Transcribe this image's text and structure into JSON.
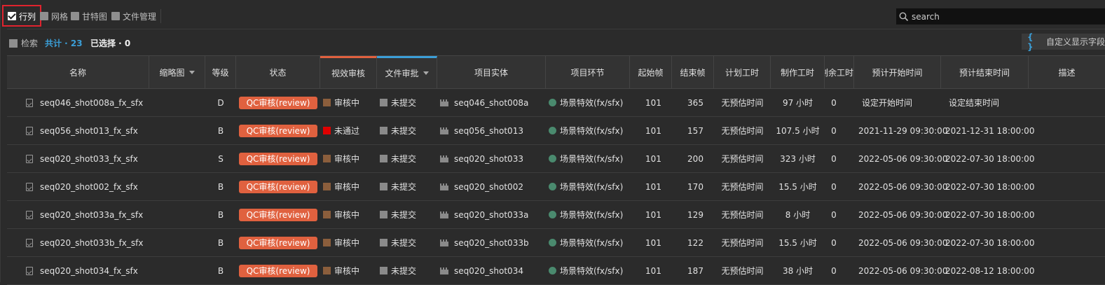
{
  "view_tabs": [
    {
      "label": "行列",
      "active": true
    },
    {
      "label": "网格",
      "active": false
    },
    {
      "label": "甘特图",
      "active": false
    },
    {
      "label": "文件管理",
      "active": false
    }
  ],
  "search": {
    "placeholder": "search"
  },
  "filter": {
    "label": "检索",
    "total_label": "共计 · 23",
    "selected_label": "已选择 · 0"
  },
  "custom_fields": {
    "icon": "{ }",
    "label": "自定义显示字段"
  },
  "columns": [
    "名称",
    "缩略图",
    "等级",
    "状态",
    "视效审核",
    "文件审批",
    "项目实体",
    "项目环节",
    "起始帧",
    "结束帧",
    "计划工时",
    "制作工时",
    "剩余工时",
    "预计开始时间",
    "预计结束时间",
    "描述"
  ],
  "colors": {
    "qc_badge": "#e0613f",
    "status_reviewing": "#8b5e3c",
    "status_rejected": "#e00000",
    "status_unsubmitted": "#8a8a8a",
    "stage_dot": "#4a8a6e",
    "date_bar": "#e56b6f",
    "highlight_border": "#e0232e",
    "accent_blue": "#3b9fd8"
  },
  "rows": [
    {
      "name": "seq046_shot008a_fx_sfx",
      "level": "D",
      "status": "QC审核(review)",
      "vfx_review": "审核中",
      "vfx_review_state": "reviewing",
      "file_approval": "未提交",
      "entity": "seq046_shot008a",
      "stage": "场景特效(fx/sfx)",
      "start_frame": "101",
      "end_frame": "365",
      "planned": "无预估时间",
      "actual": "97 小时",
      "remaining": "0",
      "est_start": "设定开始时间",
      "est_end": "设定结束时间",
      "dated": false
    },
    {
      "name": "seq056_shot013_fx_sfx",
      "level": "B",
      "status": "QC审核(review)",
      "vfx_review": "未通过",
      "vfx_review_state": "rejected",
      "file_approval": "未提交",
      "entity": "seq056_shot013",
      "stage": "场景特效(fx/sfx)",
      "start_frame": "101",
      "end_frame": "157",
      "planned": "无预估时间",
      "actual": "107.5 小时",
      "remaining": "0",
      "est_start": "2021-11-29 09:30:00",
      "est_end": "2021-12-31 18:00:00",
      "dated": true
    },
    {
      "name": "seq020_shot033_fx_sfx",
      "level": "S",
      "status": "QC审核(review)",
      "vfx_review": "审核中",
      "vfx_review_state": "reviewing",
      "file_approval": "未提交",
      "entity": "seq020_shot033",
      "stage": "场景特效(fx/sfx)",
      "start_frame": "101",
      "end_frame": "200",
      "planned": "无预估时间",
      "actual": "323 小时",
      "remaining": "0",
      "est_start": "2022-05-06 09:30:00",
      "est_end": "2022-07-30 18:00:00",
      "dated": true
    },
    {
      "name": "seq020_shot002_fx_sfx",
      "level": "B",
      "status": "QC审核(review)",
      "vfx_review": "审核中",
      "vfx_review_state": "reviewing",
      "file_approval": "未提交",
      "entity": "seq020_shot002",
      "stage": "场景特效(fx/sfx)",
      "start_frame": "101",
      "end_frame": "170",
      "planned": "无预估时间",
      "actual": "15.5 小时",
      "remaining": "0",
      "est_start": "2022-05-06 09:30:00",
      "est_end": "2022-07-30 18:00:00",
      "dated": true
    },
    {
      "name": "seq020_shot033a_fx_sfx",
      "level": "B",
      "status": "QC审核(review)",
      "vfx_review": "审核中",
      "vfx_review_state": "reviewing",
      "file_approval": "未提交",
      "entity": "seq020_shot033a",
      "stage": "场景特效(fx/sfx)",
      "start_frame": "101",
      "end_frame": "129",
      "planned": "无预估时间",
      "actual": "8 小时",
      "remaining": "0",
      "est_start": "2022-05-06 09:30:00",
      "est_end": "2022-07-30 18:00:00",
      "dated": true
    },
    {
      "name": "seq020_shot033b_fx_sfx",
      "level": "B",
      "status": "QC审核(review)",
      "vfx_review": "审核中",
      "vfx_review_state": "reviewing",
      "file_approval": "未提交",
      "entity": "seq020_shot033b",
      "stage": "场景特效(fx/sfx)",
      "start_frame": "101",
      "end_frame": "122",
      "planned": "无预估时间",
      "actual": "15.5 小时",
      "remaining": "0",
      "est_start": "2022-05-06 09:30:00",
      "est_end": "2022-07-30 18:00:00",
      "dated": true
    },
    {
      "name": "seq020_shot034_fx_sfx",
      "level": "B",
      "status": "QC审核(review)",
      "vfx_review": "审核中",
      "vfx_review_state": "reviewing",
      "file_approval": "未提交",
      "entity": "seq020_shot034",
      "stage": "场景特效(fx/sfx)",
      "start_frame": "101",
      "end_frame": "187",
      "planned": "无预估时间",
      "actual": "38 小时",
      "remaining": "0",
      "est_start": "2022-05-06 09:30:00",
      "est_end": "2022-08-12 18:00:00",
      "dated": true
    }
  ]
}
